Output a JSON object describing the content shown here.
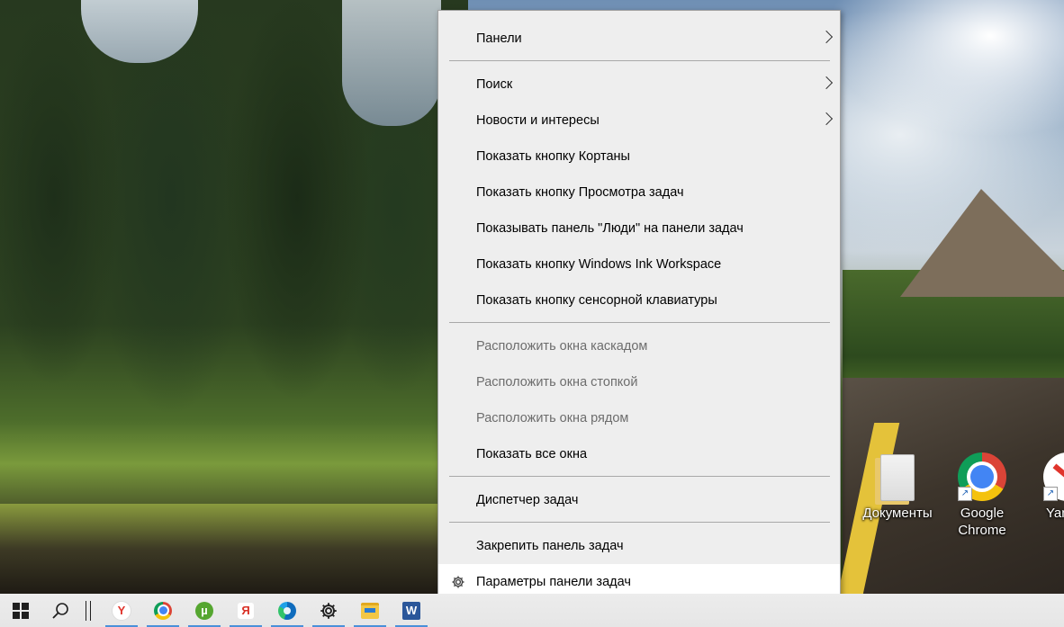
{
  "menu": {
    "items": [
      {
        "label": "Панели",
        "submenu": true,
        "disabled": false
      },
      {
        "label": "Поиск",
        "submenu": true,
        "disabled": false
      },
      {
        "label": "Новости и интересы",
        "submenu": true,
        "disabled": false
      },
      {
        "label": "Показать кнопку Кортаны",
        "submenu": false,
        "disabled": false
      },
      {
        "label": "Показать кнопку Просмотра задач",
        "submenu": false,
        "disabled": false
      },
      {
        "label": "Показывать панель \"Люди\" на панели задач",
        "submenu": false,
        "disabled": false
      },
      {
        "label": "Показать кнопку Windows Ink Workspace",
        "submenu": false,
        "disabled": false
      },
      {
        "label": "Показать кнопку сенсорной клавиатуры",
        "submenu": false,
        "disabled": false
      },
      {
        "label": "Расположить окна каскадом",
        "submenu": false,
        "disabled": true
      },
      {
        "label": "Расположить окна стопкой",
        "submenu": false,
        "disabled": true
      },
      {
        "label": "Расположить окна рядом",
        "submenu": false,
        "disabled": true
      },
      {
        "label": "Показать все окна",
        "submenu": false,
        "disabled": false
      },
      {
        "label": "Диспетчер задач",
        "submenu": false,
        "disabled": false
      },
      {
        "label": "Закрепить панель задач",
        "submenu": false,
        "disabled": false
      },
      {
        "label": "Параметры панели задач",
        "submenu": false,
        "disabled": false,
        "icon": "gear-icon",
        "hovered": true
      }
    ]
  },
  "desktop": {
    "icons": [
      {
        "label": "Документы",
        "icon": "folder-icon"
      },
      {
        "label": "Google Chrome",
        "icon": "chrome-icon"
      },
      {
        "label": "Yan",
        "icon": "yandex-browser-icon"
      }
    ]
  },
  "taskbar": {
    "items": [
      {
        "name": "start-button",
        "icon": "windows-icon"
      },
      {
        "name": "search-button",
        "icon": "search-icon"
      },
      {
        "name": "task-view-divider",
        "icon": "divider"
      },
      {
        "name": "yandex-browser",
        "icon": "yandex-browser-icon",
        "glyph": "Y",
        "color": "#e0342c"
      },
      {
        "name": "chrome",
        "icon": "chrome-icon"
      },
      {
        "name": "utorrent",
        "icon": "utorrent-icon",
        "glyph": "µ",
        "color": "#55a630"
      },
      {
        "name": "yandex",
        "icon": "yandex-icon",
        "glyph": "Я",
        "color": "#d93025"
      },
      {
        "name": "edge",
        "icon": "edge-icon"
      },
      {
        "name": "settings",
        "icon": "gear-icon"
      },
      {
        "name": "file-explorer",
        "icon": "folder-icon"
      },
      {
        "name": "word",
        "icon": "word-icon",
        "glyph": "W",
        "color": "#2b579a"
      }
    ]
  },
  "colors": {
    "menu_bg": "#eeeeee",
    "menu_hover": "#ffffff",
    "menu_text": "#000000",
    "menu_disabled_text": "#6d6d6d",
    "taskbar_bg": "#ececec",
    "accent": "#4a90d9"
  }
}
